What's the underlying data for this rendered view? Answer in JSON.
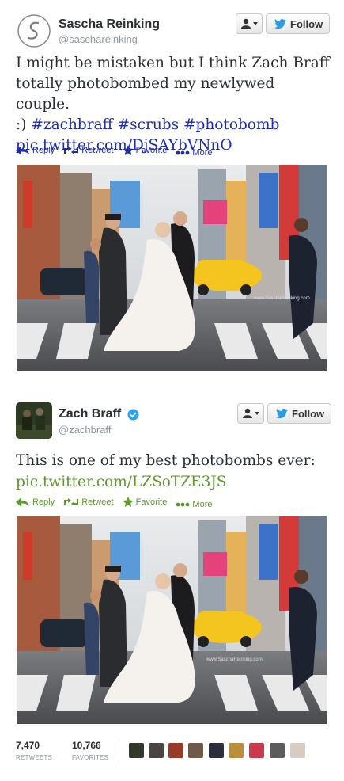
{
  "tweet1": {
    "name": "Sascha Reinking",
    "handle": "@saschareinking",
    "follow_label": "Follow",
    "text_line1": "I might be mistaken but I think Zach Braff",
    "text_line2": "totally photobombed my newlywed couple.",
    "text_smiley": ":)",
    "hashtags": [
      "#zachbraff",
      "#scrubs",
      "#photobomb"
    ],
    "link": "pic.twitter.com/DjSAYbVNnO",
    "actions": {
      "reply": "Reply",
      "retweet": "Retweet",
      "favorite": "Favorite",
      "more": "More"
    },
    "photo_watermark": "www.SaschaReinking.com"
  },
  "tweet2": {
    "name": "Zach Braff",
    "handle": "@zachbraff",
    "follow_label": "Follow",
    "text": "This is one of my best photobombs ever:",
    "link": "pic.twitter.com/LZSoTZE3JS",
    "actions": {
      "reply": "Reply",
      "retweet": "Retweet",
      "favorite": "Favorite",
      "more": "More"
    },
    "photo_watermark": "www.SaschaReinking.com",
    "retweets_count": "7,470",
    "retweets_label": "RETWEETS",
    "favorites_count": "10,766",
    "favorites_label": "FAVORITES"
  },
  "colors": {
    "link_dark_blue": "#1e2da8",
    "action_blue": "#1e2da8",
    "action_green": "#5d9a2b",
    "follow_bird": "#2a9ee0",
    "muted": "#8899a6"
  }
}
